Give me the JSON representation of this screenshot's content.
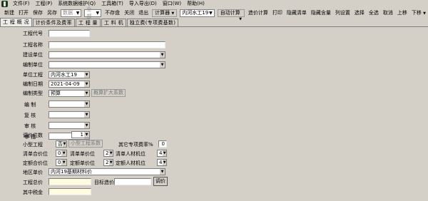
{
  "menu": [
    "文件(F)",
    "工程(P)",
    "系统数据维护(Q)",
    "工具箱(T)",
    "导入导出(D)",
    "窗口(W)",
    "帮助(H)"
  ],
  "toolbar": {
    "new": "新建",
    "open": "打开",
    "save": "保存",
    "save_as": "另存",
    "data_combo": "数据",
    "group_combo": "全部",
    "no_save": "不存盘",
    "close": "关闭",
    "exit": "退出",
    "calculator": "计算器",
    "project_combo": "内河水工19",
    "auto_calc": "自动计算",
    "price_calc": "造价计算",
    "print": "打印",
    "hide_list": "隐藏清单",
    "hide_qty": "隐藏含量",
    "col_settings": "列设置",
    "select": "选择",
    "select_all": "全选",
    "cancel": "取消",
    "move_up": "上移",
    "move_down": "下移"
  },
  "tabs": [
    "工 程 概 况",
    "计价条件及费率",
    "工 程 量",
    "工 料 机",
    "独立费(专项费基数)"
  ],
  "form": {
    "project_code": {
      "label": "工程代号",
      "value": ""
    },
    "project_name": {
      "label": "工程名称",
      "value": ""
    },
    "construction_unit": {
      "label": "建设单位",
      "value": ""
    },
    "compile_unit": {
      "label": "编制单位",
      "value": ""
    },
    "unit_project": {
      "label": "单位工程",
      "value": "内河水工19"
    },
    "compile_date": {
      "label": "编制日期",
      "value": "2021-04-09"
    },
    "compile_type": {
      "label": "编制类型",
      "value": "预算",
      "btn": "概算扩大系数"
    },
    "compiler": {
      "label": "编 制",
      "value": ""
    },
    "reviewer": {
      "label": "复 核",
      "value": ""
    },
    "auditor": {
      "label": "审 核",
      "value": ""
    },
    "approver": {
      "label": "审 批",
      "value": ""
    },
    "price_digits": {
      "label": "调价位数",
      "value": "1"
    },
    "small_project": {
      "label": "小型工程",
      "value": "否",
      "btn": "小型工程系数"
    },
    "other_special_fee": {
      "label": "其它专项费率%",
      "value": "0"
    },
    "list_qty_digits": {
      "label": "清单合价位",
      "value": "0"
    },
    "list_unit_price_digits": {
      "label": "清单单价位",
      "value": "2"
    },
    "list_labor_digits": {
      "label": "清单人材机位",
      "value": "4"
    },
    "quota_total_digits": {
      "label": "定额合价位",
      "value": "0"
    },
    "quota_unit_price_digits": {
      "label": "定额单价位",
      "value": "2"
    },
    "quota_labor_digits": {
      "label": "定额人材机位",
      "value": "4"
    },
    "region_price": {
      "label": "地区单价",
      "value": "内河19基期材料价"
    },
    "project_total": {
      "label": "工程总价",
      "value": ""
    },
    "target_price": {
      "label": "目标造价",
      "value": "",
      "btn": "调价"
    },
    "tax_included": {
      "label": "其中税金",
      "value": ""
    }
  }
}
